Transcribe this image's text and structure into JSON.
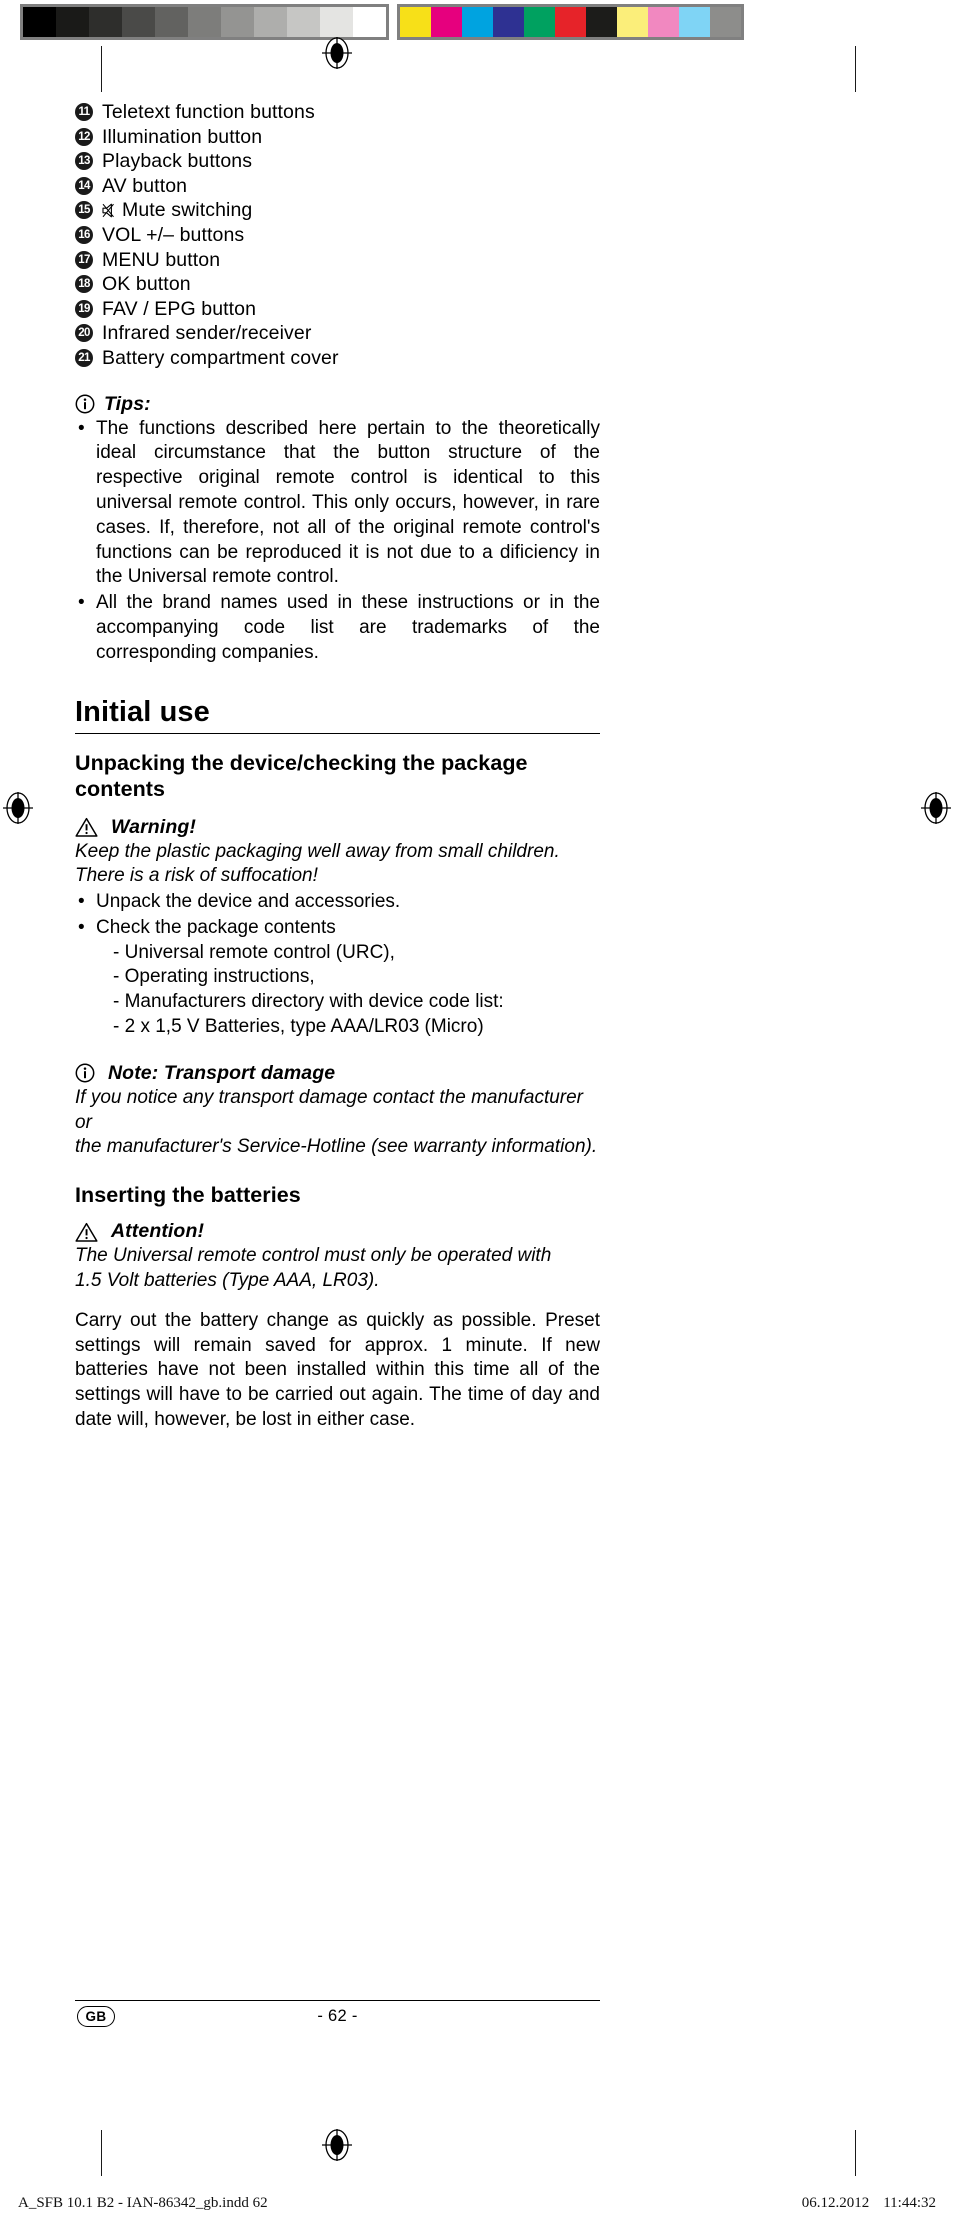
{
  "calibration": {
    "grayscale_swatches": [
      "#000000",
      "#1a1a18",
      "#2e2e2c",
      "#4a4a48",
      "#626260",
      "#7d7d7b",
      "#949492",
      "#aeaeac",
      "#c6c6c4",
      "#e4e4e2",
      "#ffffff"
    ],
    "color_swatches": [
      "#f7e018",
      "#e6007e",
      "#00a3e0",
      "#2e3192",
      "#00a160",
      "#e62329",
      "#1c1c1a",
      "#fbee7a",
      "#f188c0",
      "#7fd4f5",
      "#8d8d8b"
    ]
  },
  "numbered_items": [
    {
      "num": "11",
      "label": "Teletext function buttons",
      "icon": null
    },
    {
      "num": "12",
      "label": "Illumination button",
      "icon": null
    },
    {
      "num": "13",
      "label": "Playback buttons",
      "icon": null
    },
    {
      "num": "14",
      "label": "AV button",
      "icon": null
    },
    {
      "num": "15",
      "label": "Mute switching",
      "icon": "mute-crossed-speaker-icon"
    },
    {
      "num": "16",
      "label": "VOL +/– buttons",
      "icon": null
    },
    {
      "num": "17",
      "label": "MENU button",
      "icon": null
    },
    {
      "num": "18",
      "label": "OK button",
      "icon": null
    },
    {
      "num": "19",
      "label": "FAV / EPG button",
      "icon": null
    },
    {
      "num": "20",
      "label": "Infrared sender/receiver",
      "icon": null
    },
    {
      "num": "21",
      "label": "Battery compartment cover",
      "icon": null
    }
  ],
  "tips": {
    "title": "Tips:",
    "icon": "info-circle-icon",
    "bullet_char": "•",
    "items": [
      "The functions described here pertain to the theoretically ideal circumstance that the button structure of the respective original remote control is identical to this universal remote control. This only occurs, however, in rare cases. If, therefore, not all of the original remote control's functions can be reproduced it is not due to a dificiency in the Universal remote control.",
      "All the brand names used in these instructions or in the accompanying code list are trademarks of the corresponding companies."
    ]
  },
  "section": {
    "title": "Initial use"
  },
  "unpacking": {
    "heading": "Unpacking the device/checking the package contents",
    "warning": {
      "icon": "warning-triangle-icon",
      "title": "Warning!",
      "body_lines": [
        "Keep the plastic packaging well away from small children.",
        "There is a risk of suffocation!"
      ]
    },
    "bullet_char": "•",
    "bullets": [
      "Unpack the device and accessories.",
      "Check the package contents"
    ],
    "sub_items": [
      "- Universal remote control (URC),",
      "- Operating instructions,",
      "- Manufacturers directory with device code list:",
      "- 2 x 1,5 V Batteries, type AAA/LR03 (Micro)"
    ],
    "note": {
      "icon": "info-circle-icon",
      "title": "Note: Transport damage",
      "body_lines": [
        "If you notice any transport damage contact the manufacturer or",
        "the manufacturer's Service-Hotline (see warranty information)."
      ]
    }
  },
  "batteries": {
    "heading": "Inserting the batteries",
    "attention": {
      "icon": "warning-triangle-icon",
      "title": "Attention!",
      "body_lines": [
        "The Universal remote control must only be operated with",
        "1.5 Volt batteries (Type AAA, LR03)."
      ]
    },
    "paragraph": "Carry out the battery change as quickly as possible. Preset settings will remain saved for approx. 1 minute. If new batteries have not been installed within this time all of the settings will have to be carried out again. The time of day and date will, however, be lost in either case."
  },
  "footer": {
    "locale_badge": "GB",
    "page_number": "- 62 -"
  },
  "slug": {
    "left": "A_SFB 10.1 B2 - IAN-86342_gb.indd   62",
    "date": "06.12.2012",
    "time": "11:44:32"
  }
}
